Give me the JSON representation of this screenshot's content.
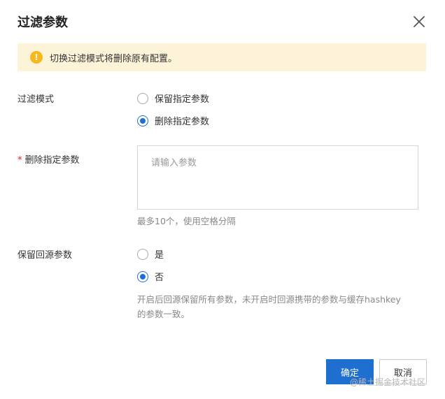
{
  "dialog": {
    "title": "过滤参数",
    "close_icon": "close-icon"
  },
  "warning": {
    "icon": "!",
    "text": "切换过滤模式将删除原有配置。",
    "colors": {
      "background": "#fdf3d8",
      "icon": "#f7b81a"
    }
  },
  "filter_mode": {
    "label": "过滤模式",
    "options": [
      {
        "label": "保留指定参数",
        "checked": false
      },
      {
        "label": "删除指定参数",
        "checked": true
      }
    ]
  },
  "delete_params": {
    "required_mark": "*",
    "label": "删除指定参数",
    "placeholder": "请输入参数",
    "value": "",
    "hint": "最多10个，使用空格分隔"
  },
  "keep_origin_params": {
    "label": "保留回源参数",
    "options": [
      {
        "label": "是",
        "checked": false
      },
      {
        "label": "否",
        "checked": true
      }
    ],
    "hint_line1": "开启后回源保留所有参数，未开启时回源携带的参数与缓存hashkey",
    "hint_line2": "的参数一致。"
  },
  "footer": {
    "confirm_label": "确定",
    "cancel_label": "取消"
  },
  "watermark": "@稀土掘金技术社区",
  "colors": {
    "primary": "#1f6fd1",
    "required": "#e02020"
  }
}
